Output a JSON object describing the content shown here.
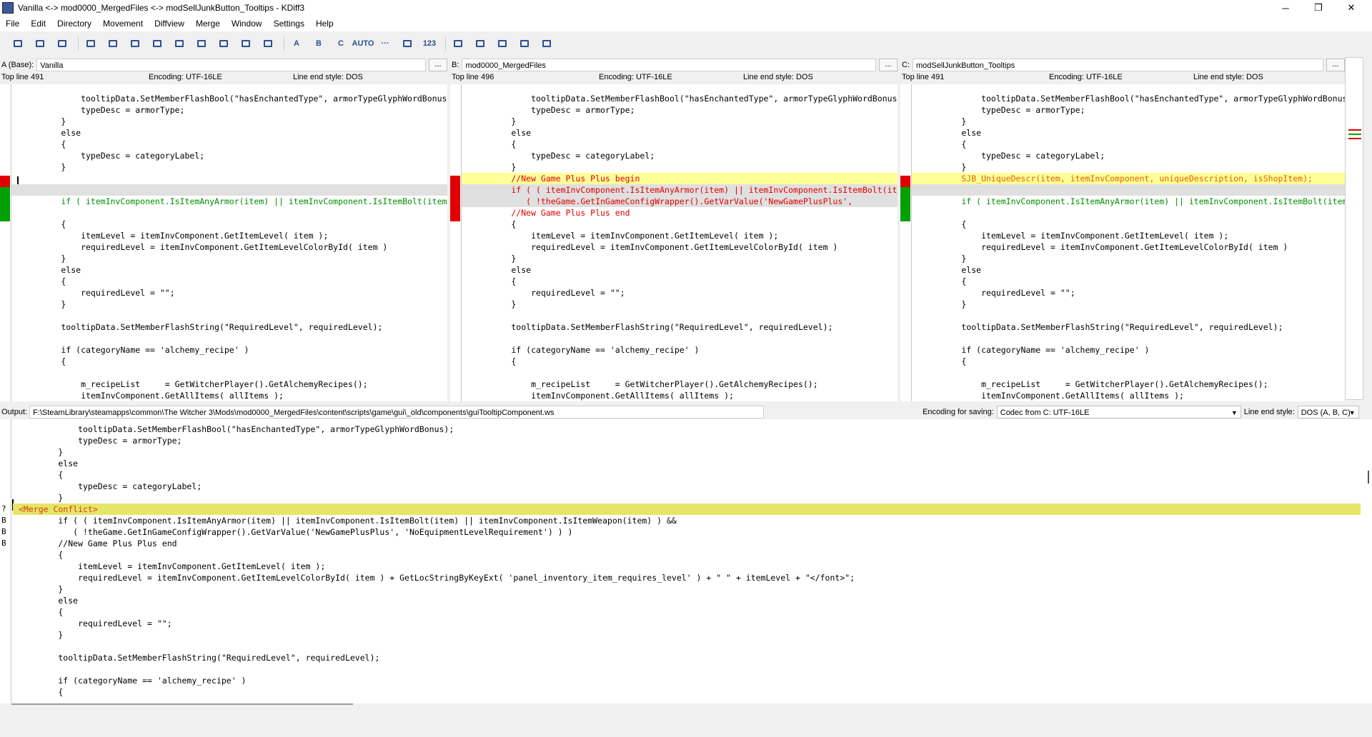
{
  "window": {
    "title": "Vanilla <-> mod0000_MergedFiles <-> modSellJunkButton_Tooltips - KDiff3",
    "minimize": "─",
    "maximize": "❐",
    "close": "✕"
  },
  "menu": [
    "File",
    "Edit",
    "Directory",
    "Movement",
    "Diffview",
    "Merge",
    "Window",
    "Settings",
    "Help"
  ],
  "toolbar": {
    "icons": [
      "open-icon",
      "save-icon",
      "print-icon",
      "goto-current-delta-icon",
      "goto-first-delta-icon",
      "goto-last-delta-icon",
      "prev-delta-icon",
      "next-delta-icon",
      "prev-conflict-icon",
      "next-conflict-icon",
      "prev-unsolved-conflict-icon",
      "next-unsolved-conflict-icon",
      "select-a-icon",
      "select-b-icon",
      "select-c-icon",
      "auto-advance-icon",
      "show-whitespace-icon",
      "show-white-space-chars-icon",
      "show-line-numbers-icon",
      "choose-a-everywhere-icon",
      "overview-normal-icon",
      "overview-ab-icon",
      "overview-ac-icon",
      "word-wrap-icon"
    ],
    "labels": [
      "",
      "",
      "",
      "",
      "",
      "",
      "",
      "",
      "",
      "",
      "",
      "",
      "A",
      "B",
      "C",
      "AUTO",
      "···",
      "",
      "123",
      "",
      "",
      "",
      "",
      ""
    ]
  },
  "panes": [
    {
      "label": "A (Base):",
      "file": "Vanilla",
      "top_line": "Top line 491",
      "encoding": "Encoding: UTF-16LE",
      "line_end": "Line end style: DOS",
      "marker_color": "#e00000",
      "marker_color2": "#00a000",
      "lines": [
        {
          "text": "            tooltipData.SetMemberFlashBool(\"hasEnchantedType\", armorTypeGlyphWordBonus);",
          "style": ""
        },
        {
          "text": "            typeDesc = armorType;",
          "style": ""
        },
        {
          "text": "        }",
          "style": ""
        },
        {
          "text": "        else",
          "style": ""
        },
        {
          "text": "        {",
          "style": ""
        },
        {
          "text": "            typeDesc = categoryLabel;",
          "style": ""
        },
        {
          "text": "        }",
          "style": ""
        },
        {
          "text": "",
          "style": "marker"
        },
        {
          "text": "",
          "style": "grey"
        },
        {
          "text": "        if ( itemInvComponent.IsItemAnyArmor(item) || itemInvComponent.IsItemBolt(item)",
          "style": "green"
        },
        {
          "text": "",
          "style": ""
        },
        {
          "text": "        {",
          "style": ""
        },
        {
          "text": "            itemLevel = itemInvComponent.GetItemLevel( item );",
          "style": ""
        },
        {
          "text": "            requiredLevel = itemInvComponent.GetItemLevelColorById( item )",
          "style": ""
        },
        {
          "text": "        }",
          "style": ""
        },
        {
          "text": "        else",
          "style": ""
        },
        {
          "text": "        {",
          "style": ""
        },
        {
          "text": "            requiredLevel = \"\";",
          "style": ""
        },
        {
          "text": "        }",
          "style": ""
        },
        {
          "text": "",
          "style": ""
        },
        {
          "text": "        tooltipData.SetMemberFlashString(\"RequiredLevel\", requiredLevel);",
          "style": ""
        },
        {
          "text": "",
          "style": ""
        },
        {
          "text": "        if (categoryName == 'alchemy_recipe' )",
          "style": ""
        },
        {
          "text": "        {",
          "style": ""
        },
        {
          "text": "",
          "style": ""
        },
        {
          "text": "            m_recipeList     = GetWitcherPlayer().GetAlchemyRecipes();",
          "style": ""
        },
        {
          "text": "            itemInvComponent.GetAllItems( allItems );",
          "style": ""
        }
      ]
    },
    {
      "label": "B:",
      "file": "mod0000_MergedFiles",
      "top_line": "Top line 496",
      "encoding": "Encoding: UTF-16LE",
      "line_end": "Line end style: DOS",
      "marker_color": "#e00000",
      "marker_color2": "#e00000",
      "lines": [
        {
          "text": "            tooltipData.SetMemberFlashBool(\"hasEnchantedType\", armorTypeGlyphWordBonus);",
          "style": ""
        },
        {
          "text": "            typeDesc = armorType;",
          "style": ""
        },
        {
          "text": "        }",
          "style": ""
        },
        {
          "text": "        else",
          "style": ""
        },
        {
          "text": "        {",
          "style": ""
        },
        {
          "text": "            typeDesc = categoryLabel;",
          "style": ""
        },
        {
          "text": "        }",
          "style": ""
        },
        {
          "text": "        //New Game Plus Plus begin",
          "style": "yellow red"
        },
        {
          "text": "        if ( ( itemInvComponent.IsItemAnyArmor(item) || itemInvComponent.IsItemBolt(item)",
          "style": "grey red"
        },
        {
          "text": "           ( !theGame.GetInGameConfigWrapper().GetVarValue('NewGamePlusPlus',",
          "style": "grey red"
        },
        {
          "text": "        //New Game Plus Plus end",
          "style": "red"
        },
        {
          "text": "        {",
          "style": ""
        },
        {
          "text": "            itemLevel = itemInvComponent.GetItemLevel( item );",
          "style": ""
        },
        {
          "text": "            requiredLevel = itemInvComponent.GetItemLevelColorById( item )",
          "style": ""
        },
        {
          "text": "        }",
          "style": ""
        },
        {
          "text": "        else",
          "style": ""
        },
        {
          "text": "        {",
          "style": ""
        },
        {
          "text": "            requiredLevel = \"\";",
          "style": ""
        },
        {
          "text": "        }",
          "style": ""
        },
        {
          "text": "",
          "style": ""
        },
        {
          "text": "        tooltipData.SetMemberFlashString(\"RequiredLevel\", requiredLevel);",
          "style": ""
        },
        {
          "text": "",
          "style": ""
        },
        {
          "text": "        if (categoryName == 'alchemy_recipe' )",
          "style": ""
        },
        {
          "text": "        {",
          "style": ""
        },
        {
          "text": "",
          "style": ""
        },
        {
          "text": "            m_recipeList     = GetWitcherPlayer().GetAlchemyRecipes();",
          "style": ""
        },
        {
          "text": "            itemInvComponent.GetAllItems( allItems );",
          "style": ""
        }
      ]
    },
    {
      "label": "C:",
      "file": "modSellJunkButton_Tooltips",
      "top_line": "Top line 491",
      "encoding": "Encoding: UTF-16LE",
      "line_end": "Line end style: DOS",
      "marker_color": "#e00000",
      "marker_color2": "#00a000",
      "lines": [
        {
          "text": "            tooltipData.SetMemberFlashBool(\"hasEnchantedType\", armorTypeGlyphWordBonus);",
          "style": ""
        },
        {
          "text": "            typeDesc = armorType;",
          "style": ""
        },
        {
          "text": "        }",
          "style": ""
        },
        {
          "text": "        else",
          "style": ""
        },
        {
          "text": "        {",
          "style": ""
        },
        {
          "text": "            typeDesc = categoryLabel;",
          "style": ""
        },
        {
          "text": "        }",
          "style": ""
        },
        {
          "text": "        SJB_UniqueDescr(item, itemInvComponent, uniqueDescription, isShopItem);",
          "style": "yellow orange"
        },
        {
          "text": "",
          "style": "grey"
        },
        {
          "text": "        if ( itemInvComponent.IsItemAnyArmor(item) || itemInvComponent.IsItemBolt(item)",
          "style": "green"
        },
        {
          "text": "",
          "style": ""
        },
        {
          "text": "        {",
          "style": ""
        },
        {
          "text": "            itemLevel = itemInvComponent.GetItemLevel( item );",
          "style": ""
        },
        {
          "text": "            requiredLevel = itemInvComponent.GetItemLevelColorById( item )",
          "style": ""
        },
        {
          "text": "        }",
          "style": ""
        },
        {
          "text": "        else",
          "style": ""
        },
        {
          "text": "        {",
          "style": ""
        },
        {
          "text": "            requiredLevel = \"\";",
          "style": ""
        },
        {
          "text": "        }",
          "style": ""
        },
        {
          "text": "",
          "style": ""
        },
        {
          "text": "        tooltipData.SetMemberFlashString(\"RequiredLevel\", requiredLevel);",
          "style": ""
        },
        {
          "text": "",
          "style": ""
        },
        {
          "text": "        if (categoryName == 'alchemy_recipe' )",
          "style": ""
        },
        {
          "text": "        {",
          "style": ""
        },
        {
          "text": "",
          "style": ""
        },
        {
          "text": "            m_recipeList     = GetWitcherPlayer().GetAlchemyRecipes();",
          "style": ""
        },
        {
          "text": "            itemInvComponent.GetAllItems( allItems );",
          "style": ""
        }
      ]
    }
  ],
  "output": {
    "label": "Output:",
    "path": "F:\\SteamLibrary\\steamapps\\common\\The Witcher 3\\Mods\\mod0000_MergedFiles\\content\\scripts\\game\\gui\\_old\\components\\guiTooltipComponent.ws",
    "encoding_label": "Encoding for saving:",
    "encoding_value": "Codec from C: UTF-16LE",
    "lineend_label": "Line end style:",
    "lineend_value": "DOS (A, B, C)",
    "lines": [
      {
        "g": "",
        "text": "            tooltipData.SetMemberFlashBool(\"hasEnchantedType\", armorTypeGlyphWordBonus);",
        "style": ""
      },
      {
        "g": "",
        "text": "            typeDesc = armorType;",
        "style": ""
      },
      {
        "g": "",
        "text": "        }",
        "style": ""
      },
      {
        "g": "",
        "text": "        else",
        "style": ""
      },
      {
        "g": "",
        "text": "        {",
        "style": ""
      },
      {
        "g": "",
        "text": "            typeDesc = categoryLabel;",
        "style": ""
      },
      {
        "g": "",
        "text": "        }",
        "style": ""
      },
      {
        "g": "?",
        "text": "<Merge Conflict>",
        "style": "conflict"
      },
      {
        "g": "B",
        "text": "        if ( ( itemInvComponent.IsItemAnyArmor(item) || itemInvComponent.IsItemBolt(item) || itemInvComponent.IsItemWeapon(item) ) &&",
        "style": ""
      },
      {
        "g": "B",
        "text": "           ( !theGame.GetInGameConfigWrapper().GetVarValue('NewGamePlusPlus', 'NoEquipmentLevelRequirement') ) )",
        "style": ""
      },
      {
        "g": "B",
        "text": "        //New Game Plus Plus end",
        "style": ""
      },
      {
        "g": "",
        "text": "        {",
        "style": ""
      },
      {
        "g": "",
        "text": "            itemLevel = itemInvComponent.GetItemLevel( item );",
        "style": ""
      },
      {
        "g": "",
        "text": "            requiredLevel = itemInvComponent.GetItemLevelColorById( item ) + GetLocStringByKeyExt( 'panel_inventory_item_requires_level' ) + \" \" + itemLevel + \"</font>\";",
        "style": ""
      },
      {
        "g": "",
        "text": "        }",
        "style": ""
      },
      {
        "g": "",
        "text": "        else",
        "style": ""
      },
      {
        "g": "",
        "text": "        {",
        "style": ""
      },
      {
        "g": "",
        "text": "            requiredLevel = \"\";",
        "style": ""
      },
      {
        "g": "",
        "text": "        }",
        "style": ""
      },
      {
        "g": "",
        "text": "",
        "style": ""
      },
      {
        "g": "",
        "text": "        tooltipData.SetMemberFlashString(\"RequiredLevel\", requiredLevel);",
        "style": ""
      },
      {
        "g": "",
        "text": "",
        "style": ""
      },
      {
        "g": "",
        "text": "        if (categoryName == 'alchemy_recipe' )",
        "style": ""
      },
      {
        "g": "",
        "text": "        {",
        "style": ""
      }
    ]
  }
}
